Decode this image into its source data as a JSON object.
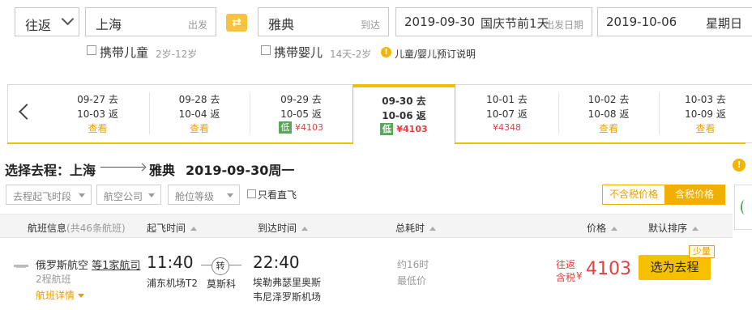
{
  "search": {
    "trip_type": "往返",
    "from_city": "上海",
    "from_tag": "出发",
    "to_city": "雅典",
    "to_tag": "到达",
    "dep_date": "2019-09-30",
    "dep_holiday": "国庆节前1天",
    "dep_tag": "出发日期",
    "ret_date": "2019-10-06",
    "ret_weekday": "星期日"
  },
  "options": {
    "child_label": "携带儿童",
    "child_age": "2岁-12岁",
    "infant_label": "携带婴儿",
    "infant_age": "14天-2岁",
    "info_icon": "!",
    "info_text": "儿童/婴儿预订说明"
  },
  "date_tabs": [
    {
      "go": "09-27 去",
      "back": "10-03 返",
      "action": "查看",
      "price": "",
      "low": ""
    },
    {
      "go": "09-28 去",
      "back": "10-04 返",
      "action": "查看",
      "price": "",
      "low": ""
    },
    {
      "go": "09-29 去",
      "back": "10-05 返",
      "action": "",
      "price": "¥4103",
      "low": "低"
    },
    {
      "go": "09-30 去",
      "back": "10-06 返",
      "action": "",
      "price": "¥4103",
      "low": "低"
    },
    {
      "go": "10-01 去",
      "back": "10-07 返",
      "action": "",
      "price": "¥4348",
      "low": ""
    },
    {
      "go": "10-02 去",
      "back": "10-08 返",
      "action": "查看",
      "price": "",
      "low": ""
    },
    {
      "go": "10-03 去",
      "back": "10-09 返",
      "action": "查看",
      "price": "",
      "low": ""
    }
  ],
  "selection": {
    "prefix": "选择去程：上海",
    "dest": "雅典",
    "date": "2019-09-30周一",
    "side_icon": "!"
  },
  "filters": {
    "dep_time": "去程起飞时段",
    "airline": "航空公司",
    "cabin": "舱位等级",
    "direct_only": "只看直飞",
    "price_excl": "不含税价格",
    "price_incl": "含税价格"
  },
  "table_header": {
    "flight_info": "航班信息",
    "flight_count": "(共46条航班)",
    "dep_time": "起飞时间",
    "arr_time": "到达时间",
    "duration": "总耗时",
    "price": "价格",
    "sort": "默认排序"
  },
  "flight": {
    "airline": "俄罗斯航空",
    "airline_more": "等1家航司",
    "legs": "2程航班",
    "detail_link": "航班详情",
    "dep_time": "11:40",
    "dep_airport": "浦东机场T2",
    "transfer_icon": "转",
    "transfer_city": "莫斯科",
    "arr_time": "22:40",
    "arr_airport": "埃勒弗瑟里奥斯韦尼泽罗斯机场",
    "duration": "约16时",
    "lowest": "最低价",
    "price_label_1": "往返",
    "price_label_2": "含税",
    "currency": "¥",
    "price": "4103",
    "select_label": "选为去程",
    "seats_badge": "少量"
  },
  "colors": {
    "accent": "#f5c000",
    "price_red": "#e34040",
    "low_green": "#58a85a"
  }
}
